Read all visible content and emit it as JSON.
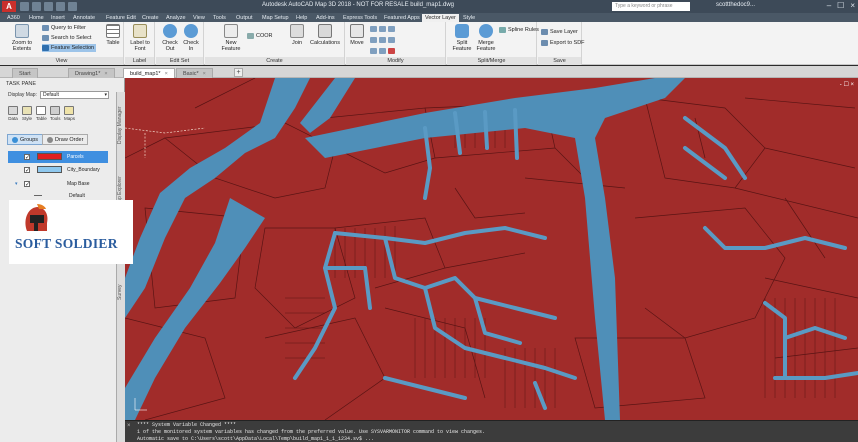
{
  "titlebar": {
    "app_logo": "A",
    "app_menu": "A360",
    "window_title": "Autodesk AutoCAD Map 3D 2018 - NOT FOR RESALE   build_map1.dwg",
    "search_placeholder": "Type a keyword or phrase",
    "user": "scottthedoc9..."
  },
  "menu": {
    "tabs": [
      "Home",
      "Insert",
      "Annotate",
      "Feature Edit",
      "Create",
      "Analyze",
      "View",
      "Tools",
      "Output",
      "Map Setup",
      "Help",
      "Add-ins",
      "Express Tools",
      "Featured Apps",
      "Vector Layer",
      "Style"
    ],
    "active": "Vector Layer"
  },
  "ribbon": {
    "view": {
      "title": "View",
      "zoom_label": "Zoom to Extents",
      "query_filter": "Query to Filter",
      "search_select": "Search to Select",
      "feature_selection": "Feature Selection",
      "table_label": "Table"
    },
    "label_feature": {
      "title": "Label Feature",
      "button": "Label to Font"
    },
    "edit_set": {
      "title": "Edit Set",
      "check_out": "Check Out",
      "check_in": "Check In"
    },
    "create": {
      "title": "Create",
      "new_feature": "New Feature",
      "join": "Join",
      "calculations": "Calculations",
      "coor": "COOR"
    },
    "modify": {
      "title": "Modify",
      "move": "Move"
    },
    "split_merge": {
      "title": "Split/Merge",
      "split": "Split Feature",
      "merge": "Merge Feature",
      "spline_rules": "Spline Rules"
    },
    "save": {
      "title": "Save",
      "save_layer": "Save Layer",
      "export_sdf": "Export to SDF"
    }
  },
  "doc_tabs": [
    {
      "label": "Start",
      "active": false
    },
    {
      "label": "Drawing1*",
      "active": false
    },
    {
      "label": "build_map1*",
      "active": true
    },
    {
      "label": "Basic*",
      "active": false
    }
  ],
  "left_pane": {
    "title": "TASK PANE",
    "display_map_label": "Display Map:",
    "display_map_value": "Default",
    "tools": [
      "Data",
      "Style",
      "Table",
      "Tools",
      "Maps"
    ],
    "view_tabs": [
      "Groups",
      "Draw Order"
    ],
    "layers": [
      {
        "name": "Parcels",
        "color": "#e02020",
        "selected": true
      },
      {
        "name": "City_Boundary",
        "color": "#8fc8ee",
        "selected": false
      }
    ],
    "map_base": "Map Base",
    "default_item": "Default",
    "side_tabs": [
      "Display Manager",
      "Map Explorer",
      "Survey"
    ]
  },
  "logo": {
    "text": "SOFT SOLDIER"
  },
  "viewport": {
    "controls": "- ☐ ×"
  },
  "command": {
    "lines": [
      "**** System Variable Changed ****",
      "1 of the monitored system variables has changed from the preferred value. Use SYSVARMONITOR command to view changes.",
      "Automatic save to C:\\Users\\scott\\AppData\\Local\\Temp\\build_map1_1_1_1234.sv$ ..."
    ],
    "close": "×"
  },
  "colors": {
    "parcel_fill": "#a12c2a",
    "water": "#4f8fb8",
    "road": "#5a9ac4",
    "accent": "#3f8fe0"
  }
}
